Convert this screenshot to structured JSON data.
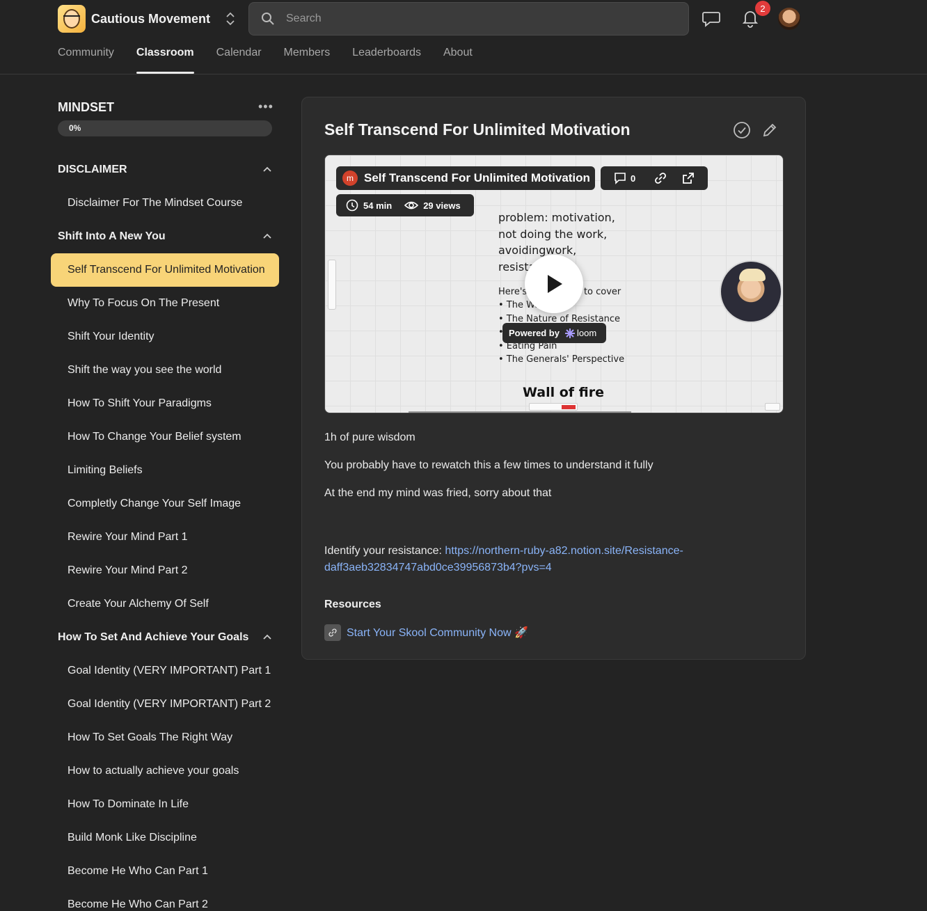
{
  "app": {
    "group_name": "Cautious Movement",
    "notification_count": "2"
  },
  "search": {
    "placeholder": "Search"
  },
  "nav": {
    "tabs": [
      "Community",
      "Classroom",
      "Calendar",
      "Members",
      "Leaderboards",
      "About"
    ],
    "active_tab": "Classroom"
  },
  "course": {
    "title": "MINDSET",
    "progress_label": "0%",
    "progress": 0,
    "sections": [
      {
        "title": "DISCLAIMER",
        "lessons": [
          "Disclaimer For The Mindset Course"
        ]
      },
      {
        "title": "Shift Into A New You",
        "lessons": [
          "Self Transcend For Unlimited Motivation",
          "Why To Focus On The Present",
          "Shift Your Identity",
          "Shift the way you see the world",
          "How To Shift Your Paradigms",
          "How To Change Your Belief system",
          "Limiting Beliefs",
          "Completly Change Your Self Image",
          "Rewire Your Mind Part 1",
          "Rewire Your Mind Part 2",
          "Create Your Alchemy Of Self"
        ]
      },
      {
        "title": "How To Set And Achieve Your Goals",
        "lessons": [
          "Goal Identity (VERY IMPORTANT) Part 1",
          "Goal Identity (VERY IMPORTANT) Part 2",
          "How To Set Goals The Right Way",
          "How to actually achieve your goals",
          "How To Dominate In Life",
          "Build Monk Like Discipline",
          "Become He Who Can Part 1",
          "Become He Who Can Part 2"
        ]
      }
    ],
    "active_lesson": "Self Transcend For Unlimited Motivation"
  },
  "lesson": {
    "title": "Self Transcend For Unlimited Motivation",
    "video": {
      "owner_initial": "m",
      "title": "Self Transcend For Unlimited Motivation",
      "comments": "0",
      "duration": "54 min",
      "views": "29 views",
      "powered_by": "Powered by",
      "brand": "loom",
      "slide_lines": [
        "problem: motivation,",
        "not doing the work,",
        "avoidingwork,",
        "resista"
      ],
      "slide_list_intro": "Here's          going to cover",
      "slide_list": [
        "• The Wa",
        "• The Nature of Resistance",
        "•",
        "• Eating Pain",
        "• The Generals' Perspective"
      ],
      "slide_heading": "Wall of fire"
    },
    "description": [
      "1h of pure wisdom",
      "You probably have to rewatch this a few times to understand it fully",
      "At the end my mind was fried, sorry about that"
    ],
    "resistance_label": "Identify your resistance: ",
    "resistance_link_1": "https://northern-ruby-a82.notion.site/Resistance-",
    "resistance_link_2": "daff3aeb32834747abd0ce39956873b4?pvs=4",
    "resources_title": "Resources",
    "resources": [
      "Start Your Skool Community Now 🚀"
    ]
  },
  "colors": {
    "background": "#232323",
    "card": "#2c2c2c",
    "active_lesson": "#f8d478",
    "link": "#8ab4f8",
    "badge": "#e23b3b"
  },
  "icons": [
    "search-icon",
    "chat-icon",
    "bell-icon",
    "chevron-up-icon",
    "more-icon",
    "check-circle-icon",
    "pencil-icon",
    "play-icon",
    "comment-icon",
    "link-icon",
    "external-link-icon",
    "clock-icon",
    "eye-icon",
    "switch-icon"
  ]
}
